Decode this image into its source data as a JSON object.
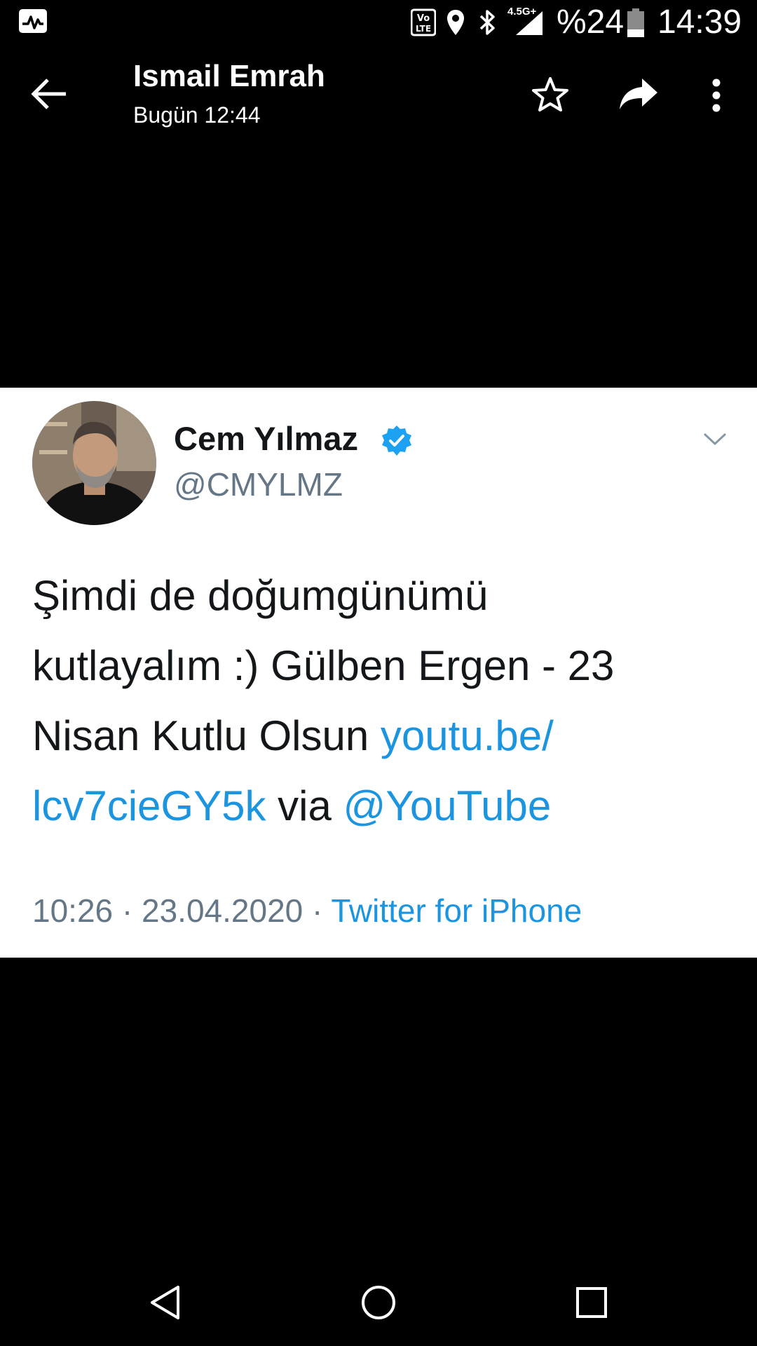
{
  "status_bar": {
    "network_label": "4.5G+",
    "volte_label": "VoLTE",
    "battery": "%24",
    "time": "14:39"
  },
  "app_bar": {
    "title": "Ismail Emrah",
    "subtitle": "Bugün 12:44",
    "icons": [
      "back-arrow-icon",
      "star-icon",
      "forward-icon",
      "more-vert-icon"
    ]
  },
  "tweet": {
    "author_name": "Cem Yılmaz",
    "verified": true,
    "handle": "@CMYLMZ",
    "text_line_1": "Şimdi de doğumgünümü",
    "text_line_2": "kutlayalım :) Gülben Ergen - 23",
    "text_line_3_plain": "Nisan Kutlu Olsun ",
    "link_part_1": "youtu.be/",
    "link_part_2": "lcv7cieGY5k",
    "via_text": " via ",
    "mention": "@YouTube",
    "time": "10:26",
    "separator": " · ",
    "date": "23.04.2020",
    "source": "Twitter for iPhone"
  },
  "colors": {
    "background": "#000000",
    "card": "#ffffff",
    "link": "#1b95e0",
    "verified": "#1da1f2",
    "secondary_text": "#657786",
    "primary_text": "#14171a"
  }
}
